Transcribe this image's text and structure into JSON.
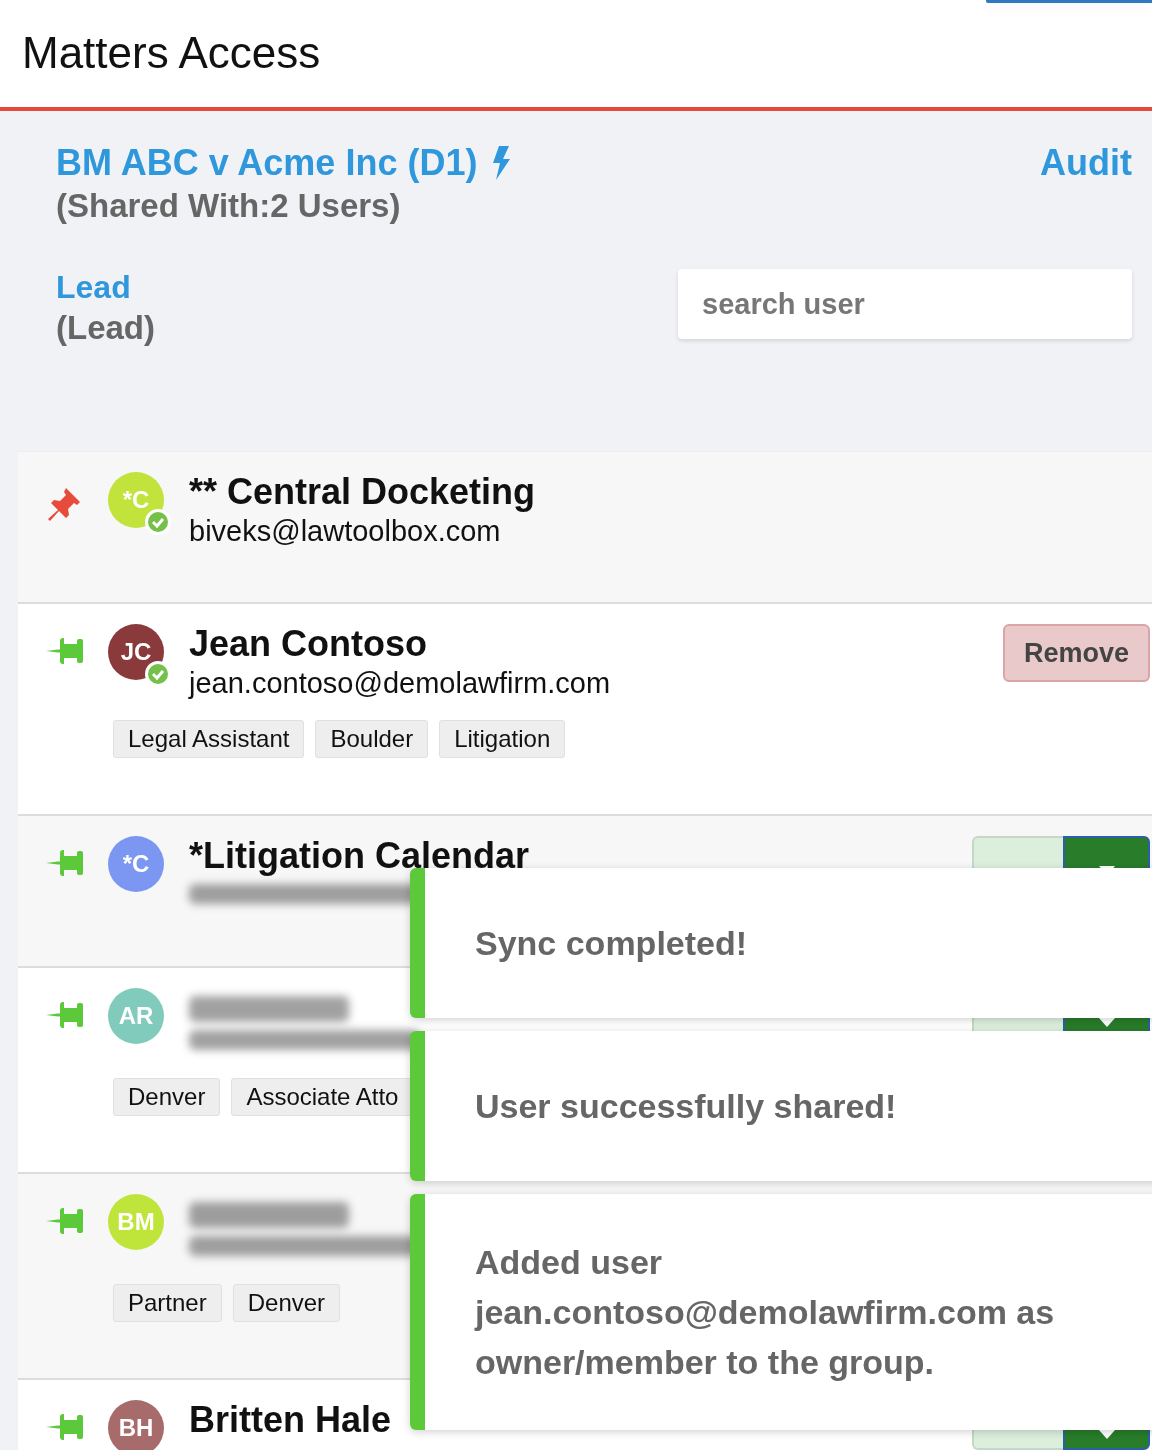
{
  "header": {
    "title": "Matters Access"
  },
  "matter": {
    "name": "BM ABC v Acme Inc (D1)",
    "shared": "(Shared With:2 Users)",
    "audit": "Audit",
    "lead_link": "Lead",
    "lead_role": "(Lead)",
    "search": {
      "placeholder": "search user"
    }
  },
  "users": [
    {
      "initials": "*C",
      "color": "#c2e23c",
      "verified": true,
      "pinned": true,
      "name": "** Central Docketing",
      "email": "biveks@lawtoolbox.com"
    },
    {
      "initials": "JC",
      "color": "#8b3a3c",
      "verified": true,
      "pinned": false,
      "name": "Jean Contoso",
      "email": "jean.contoso@demolawfirm.com",
      "tags": [
        "Legal Assistant",
        "Boulder",
        "Litigation"
      ],
      "action": {
        "kind": "remove",
        "label": "Remove"
      }
    },
    {
      "initials": "*C",
      "color": "#7b97f1",
      "verified": false,
      "pinned": false,
      "name": "*Litigation Calendar",
      "email_redacted": true,
      "action": {
        "kind": "add"
      }
    },
    {
      "initials": "AR",
      "color": "#80cbbb",
      "verified": false,
      "pinned": false,
      "name_redacted": true,
      "email_redacted": true,
      "tags": [
        "Denver",
        "Associate Atto"
      ],
      "action": {
        "kind": "add"
      }
    },
    {
      "initials": "BM",
      "color": "#bfe53a",
      "verified": false,
      "pinned": false,
      "name_redacted": true,
      "email_redacted": true,
      "tags": [
        "Partner",
        "Denver"
      ]
    },
    {
      "initials": "BH",
      "color": "#a86b6b",
      "verified": false,
      "pinned": false,
      "name": "Britten Hale",
      "action": {
        "kind": "add"
      }
    }
  ],
  "toasts": [
    {
      "message": "Sync completed!"
    },
    {
      "message": "User successfully shared!"
    },
    {
      "message": "Added user jean.contoso@demolawfirm.com as owner/member to the group."
    }
  ]
}
